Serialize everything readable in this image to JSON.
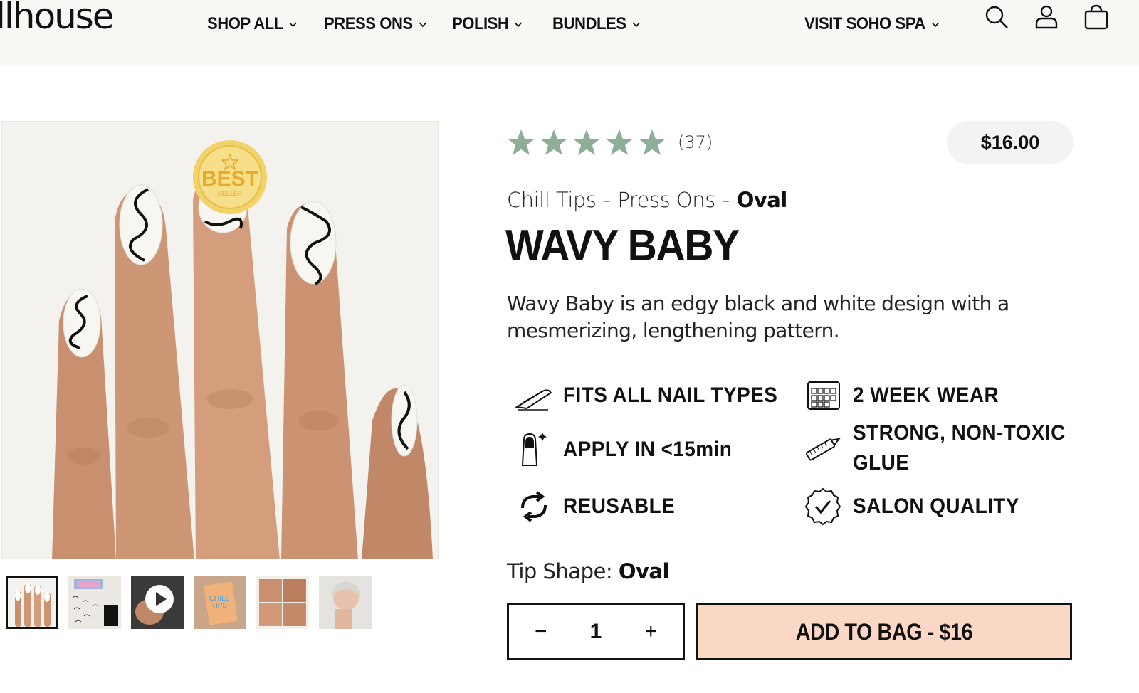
{
  "header": {
    "logo_text": "llhouse",
    "nav": [
      {
        "label": "SHOP ALL"
      },
      {
        "label": "PRESS ONS"
      },
      {
        "label": "POLISH"
      },
      {
        "label": "BUNDLES"
      },
      {
        "label": "VISIT SOHO SPA"
      }
    ],
    "icons": [
      "search-icon",
      "account-icon",
      "cart-icon"
    ]
  },
  "gallery": {
    "badge_text": "BEST",
    "badge_subtext": "SELLER",
    "thumbnails": [
      "hand-thumbnail",
      "packaging-thumbnail",
      "video-thumbnail",
      "box-thumbnail",
      "steps-thumbnail",
      "model-thumbnail"
    ]
  },
  "product": {
    "rating": 5,
    "review_count": "(37)",
    "price": "$16.00",
    "breadcrumb": {
      "line": "Chill Tips",
      "type": "Press Ons",
      "shape": "Oval"
    },
    "title": "WAVY BABY",
    "description": "Wavy Baby is an edgy black and white design with a mesmerizing, lengthening pattern.",
    "features": [
      {
        "label": "FITS ALL NAIL TYPES",
        "icon": "nail-file-icon"
      },
      {
        "label": "2 WEEK WEAR",
        "icon": "calendar-icon"
      },
      {
        "label": "APPLY IN <15min",
        "icon": "nail-apply-icon"
      },
      {
        "label": "STRONG, NON-TOXIC GLUE",
        "icon": "glue-icon"
      },
      {
        "label": "REUSABLE",
        "icon": "reuse-icon"
      },
      {
        "label": "SALON QUALITY",
        "icon": "check-badge-icon"
      }
    ],
    "tip_shape_label": "Tip Shape:",
    "tip_shape_value": "Oval",
    "quantity": "1",
    "minus": "−",
    "plus": "+",
    "add_to_bag": "ADD TO BAG - $16"
  },
  "colors": {
    "star": "#8fae98",
    "add_button": "#fbd8c5",
    "header_bg": "#f8f8f5"
  }
}
